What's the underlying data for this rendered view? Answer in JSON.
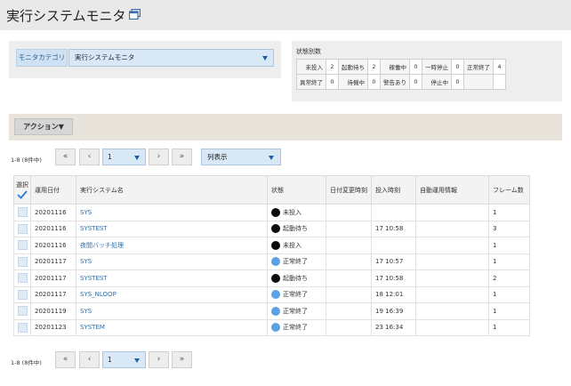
{
  "header": {
    "title": "実行システムモニタ",
    "window_icon": "window-restore-icon"
  },
  "category": {
    "label": "モニタカテゴリ",
    "selected": "実行システムモニタ"
  },
  "status_counts": {
    "title": "状態別数",
    "rows": [
      [
        {
          "label": "未投入",
          "value": "2"
        },
        {
          "label": "起動待ち",
          "value": "2"
        },
        {
          "label": "稼働中",
          "value": "0"
        },
        {
          "label": "一時停止",
          "value": "0"
        },
        {
          "label": "正常終了",
          "value": "4"
        }
      ],
      [
        {
          "label": "異常終了",
          "value": "0"
        },
        {
          "label": "待機中",
          "value": "0"
        },
        {
          "label": "警告あり",
          "value": "0"
        },
        {
          "label": "停止中",
          "value": "0"
        }
      ]
    ]
  },
  "action": {
    "label": "アクション▼"
  },
  "pager": {
    "count_text": "1-8 (8件中)",
    "first": "«",
    "prev": "‹",
    "next": "›",
    "last": "»",
    "page": "1",
    "view_label": "列表示"
  },
  "table": {
    "headers": {
      "select": "選択",
      "date": "運用日付",
      "system": "実行システム名",
      "status": "状態",
      "date_change": "日付変更時刻",
      "input_time": "投入時刻",
      "auto_info": "自動運用情報",
      "frames": "フレーム数"
    },
    "status_colors": {
      "black": "#0b0b0b",
      "blue": "#5aa2e6"
    },
    "rows": [
      {
        "date": "20201116",
        "system": "SYS",
        "status": "未投入",
        "dot": "black",
        "date_change": "",
        "input_time": "",
        "auto_info": "",
        "frames": "1"
      },
      {
        "date": "20201116",
        "system": "SYSTEST",
        "status": "起動待ち",
        "dot": "black",
        "date_change": "",
        "input_time": "17 10:58",
        "auto_info": "",
        "frames": "3"
      },
      {
        "date": "20201116",
        "system": "夜間バッチ処理",
        "status": "未投入",
        "dot": "black",
        "date_change": "",
        "input_time": "",
        "auto_info": "",
        "frames": "1"
      },
      {
        "date": "20201117",
        "system": "SYS",
        "status": "正常終了",
        "dot": "blue",
        "date_change": "",
        "input_time": "17 10:57",
        "auto_info": "",
        "frames": "1"
      },
      {
        "date": "20201117",
        "system": "SYSTEST",
        "status": "起動待ち",
        "dot": "black",
        "date_change": "",
        "input_time": "17 10:58",
        "auto_info": "",
        "frames": "2"
      },
      {
        "date": "20201117",
        "system": "SYS_NLOOP",
        "status": "正常終了",
        "dot": "blue",
        "date_change": "",
        "input_time": "18 12:01",
        "auto_info": "",
        "frames": "1"
      },
      {
        "date": "20201119",
        "system": "SYS",
        "status": "正常終了",
        "dot": "blue",
        "date_change": "",
        "input_time": "19 16:39",
        "auto_info": "",
        "frames": "1"
      },
      {
        "date": "20201123",
        "system": "SYSTEM",
        "status": "正常終了",
        "dot": "blue",
        "date_change": "",
        "input_time": "23 16:34",
        "auto_info": "",
        "frames": "1"
      }
    ]
  }
}
